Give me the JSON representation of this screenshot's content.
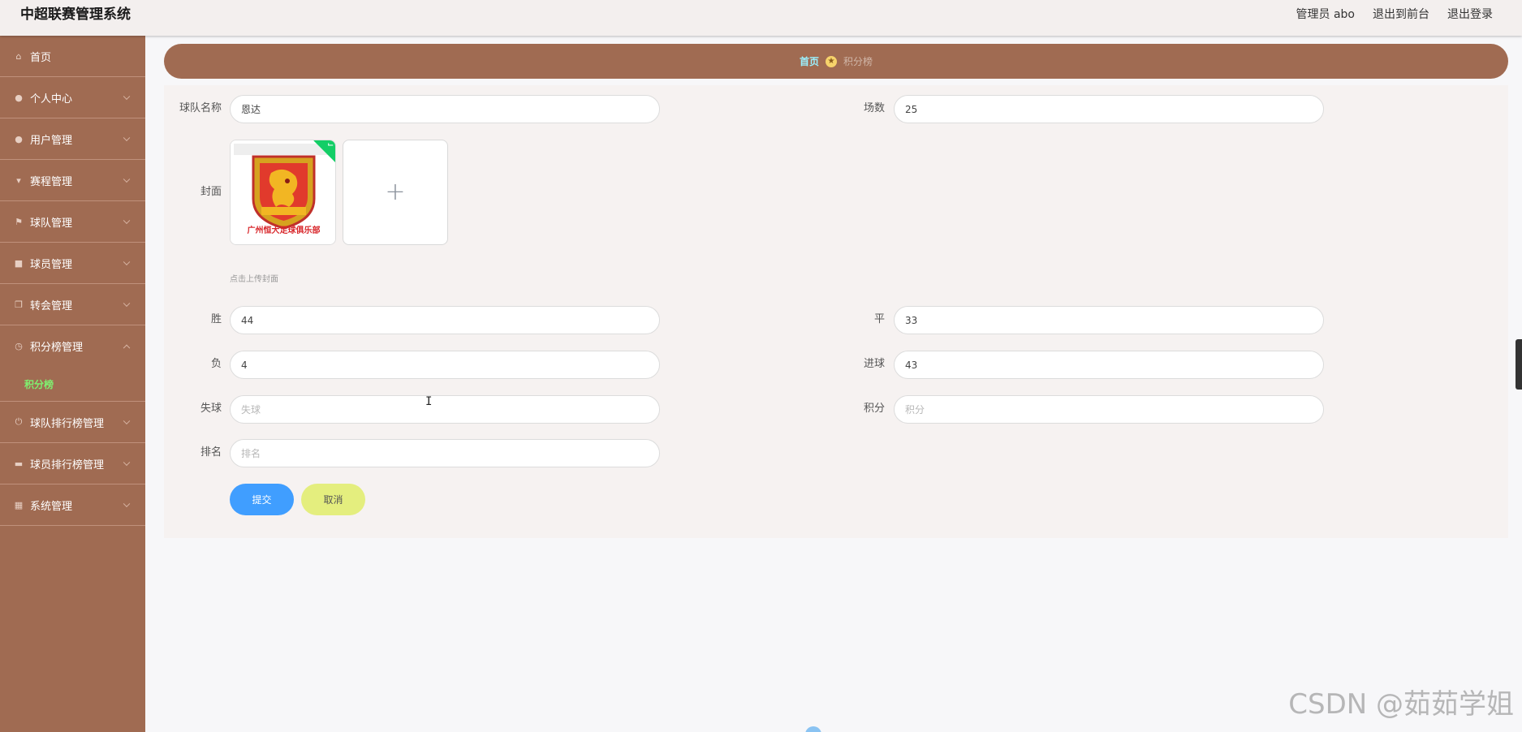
{
  "header": {
    "title": "中超联赛管理系统",
    "user": "管理员 abo",
    "to_front": "退出到前台",
    "logout": "退出登录"
  },
  "sidebar": {
    "items": [
      {
        "label": "首页",
        "icon": "home-icon"
      },
      {
        "label": "个人中心",
        "icon": "user-icon"
      },
      {
        "label": "用户管理",
        "icon": "location-icon"
      },
      {
        "label": "赛程管理",
        "icon": "trophy-icon"
      },
      {
        "label": "球队管理",
        "icon": "flag-icon"
      },
      {
        "label": "球员管理",
        "icon": "clipboard-icon"
      },
      {
        "label": "转会管理",
        "icon": "copy-icon"
      },
      {
        "label": "积分榜管理",
        "icon": "clock-icon",
        "open": true,
        "sub": [
          "积分榜"
        ]
      },
      {
        "label": "球队排行榜管理",
        "icon": "power-icon"
      },
      {
        "label": "球员排行榜管理",
        "icon": "chat-icon"
      },
      {
        "label": "系统管理",
        "icon": "grid-icon"
      }
    ],
    "active_sub_color": "#7ff070"
  },
  "breadcrumb": {
    "home": "首页",
    "current": "积分榜"
  },
  "form": {
    "team_name": {
      "label": "球队名称",
      "value": "恩达"
    },
    "matches": {
      "label": "场数",
      "value": "25"
    },
    "cover": {
      "label": "封面",
      "hint": "点击上传封面",
      "badge_text": "广州恒大足球俱乐部"
    },
    "win": {
      "label": "胜",
      "value": "44"
    },
    "draw": {
      "label": "平",
      "value": "33"
    },
    "loss": {
      "label": "负",
      "value": "4"
    },
    "goals_for": {
      "label": "进球",
      "value": "43"
    },
    "goals_against": {
      "label": "失球",
      "value": "",
      "placeholder": "失球"
    },
    "points": {
      "label": "积分",
      "value": "",
      "placeholder": "积分"
    },
    "rank": {
      "label": "排名",
      "value": "",
      "placeholder": "排名"
    },
    "submit": "提交",
    "cancel": "取消"
  },
  "watermark": "CSDN @茹茹学姐",
  "colors": {
    "sidebar": "#a06b52",
    "submit": "#409eff",
    "cancel": "#e4ee7e",
    "crumb_home": "#9af1ff"
  }
}
